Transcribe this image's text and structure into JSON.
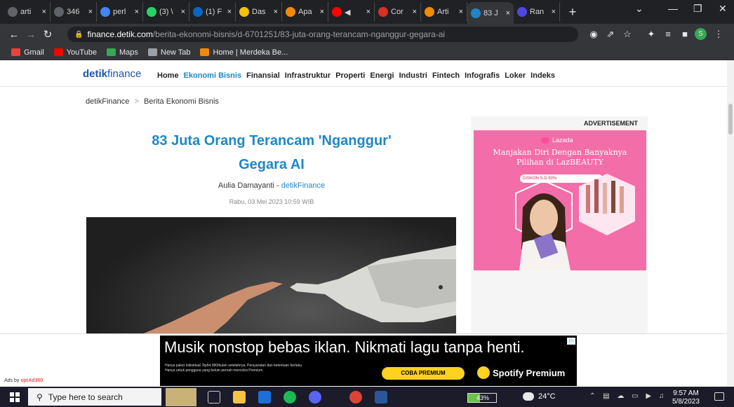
{
  "browser": {
    "tabs": [
      {
        "title": "arti",
        "favicon_color": "#5f6368"
      },
      {
        "title": "346",
        "favicon_color": "#5f6368"
      },
      {
        "title": "perl",
        "favicon_color": "#4285f4"
      },
      {
        "title": "(3) \\",
        "favicon_color": "#25d366"
      },
      {
        "title": "(1) F",
        "favicon_color": "#0a66c2"
      },
      {
        "title": "Das",
        "favicon_color": "#f4c20d"
      },
      {
        "title": "Apa",
        "favicon_color": "#f28b00"
      },
      {
        "title": "◀",
        "favicon_color": "#ff0000"
      },
      {
        "title": "Cor",
        "favicon_color": "#d93025"
      },
      {
        "title": "Arti",
        "favicon_color": "#f28b00"
      },
      {
        "title": "83 J",
        "favicon_color": "#1e86c8"
      },
      {
        "title": "Ran",
        "favicon_color": "#4f46e5"
      }
    ],
    "new_tab_label": "+",
    "url_host": "finance.detik.com",
    "url_path": "/berita-ekonomi-bisnis/d-6701251/83-juta-orang-terancam-nganggur-gegara-ai",
    "profile_initial": "S",
    "bookmarks": [
      {
        "label": "Gmail",
        "color": "#ea4335"
      },
      {
        "label": "YouTube",
        "color": "#ff0000"
      },
      {
        "label": "Maps",
        "color": "#34a853"
      },
      {
        "label": "New Tab",
        "color": "#9aa0a6"
      },
      {
        "label": "Home | Merdeka Be...",
        "color": "#f28b00"
      }
    ]
  },
  "site": {
    "logo_bold": "detik",
    "logo_rest": "finance",
    "menu": [
      "Home",
      "Ekonomi Bisnis",
      "Finansial",
      "Infrastruktur",
      "Properti",
      "Energi",
      "Industri",
      "Fintech",
      "Infografis",
      "Loker",
      "Indeks"
    ],
    "menu_active": "Ekonomi Bisnis",
    "breadcrumb_root": "detikFinance",
    "breadcrumb_sep": ">",
    "breadcrumb_current": "Berita Ekonomi Bisnis",
    "accent": "#1e88c8"
  },
  "article": {
    "headline_line1": "83 Juta Orang Terancam 'Nganggur'",
    "headline_line2": "Gegara AI",
    "author": "Aulia Damayanti",
    "byline_sep": " - ",
    "source": "detikFinance",
    "date": "Rabu, 03 Mei 2023 10:59 WIB"
  },
  "side_ad": {
    "label": "ADVERTISEMENT",
    "brand": "Lazada",
    "title_line1": "Manjakan Diri Dengan Banyaknya",
    "title_line2": "Pilihan di LazBEAUTY",
    "pill_text": "DISKON S.D 50%",
    "bg": "#f36da8"
  },
  "bottom_ad": {
    "headline": "Musik nonstop bebas iklan. Nikmati lagu tanpa henti.",
    "fine_print_1": "Hanya paket Individual. Rp54.990/bulan setelahnya. Persyaratan dan ketentuan berlaku.",
    "fine_print_2": "Hanya untuk pengguna yang belum pernah mencoba Premium.",
    "cta": "COBA PREMIUM",
    "brand": "Spotify Premium",
    "ads_by_prefix": "Ads by ",
    "ads_by_brand": "optAd360"
  },
  "taskbar": {
    "search_placeholder": "Type here to search",
    "battery_text": "43%",
    "battery_level": 0.43,
    "temperature": "24°C",
    "time": "9:57 AM",
    "date": "5/8/2023"
  }
}
